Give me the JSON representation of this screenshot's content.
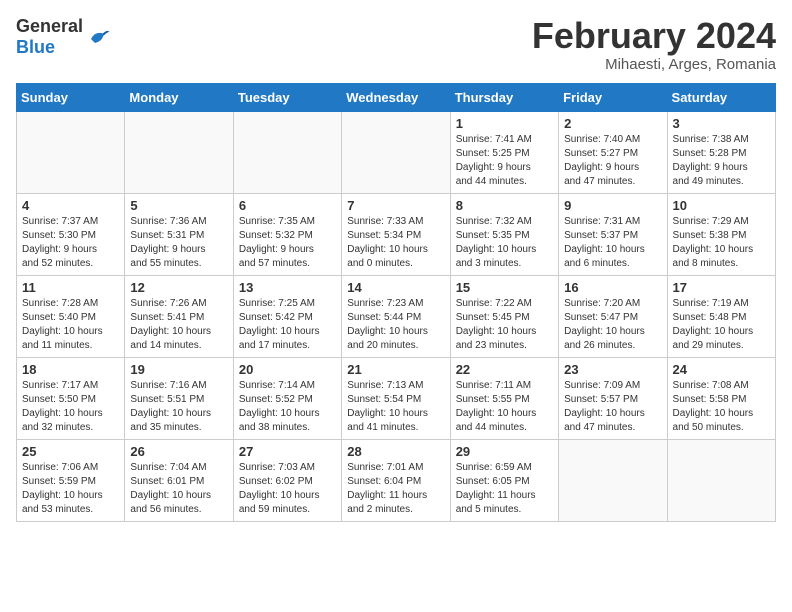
{
  "logo": {
    "general": "General",
    "blue": "Blue"
  },
  "title": "February 2024",
  "subtitle": "Mihaesti, Arges, Romania",
  "headers": [
    "Sunday",
    "Monday",
    "Tuesday",
    "Wednesday",
    "Thursday",
    "Friday",
    "Saturday"
  ],
  "weeks": [
    [
      {
        "num": "",
        "info": ""
      },
      {
        "num": "",
        "info": ""
      },
      {
        "num": "",
        "info": ""
      },
      {
        "num": "",
        "info": ""
      },
      {
        "num": "1",
        "info": "Sunrise: 7:41 AM\nSunset: 5:25 PM\nDaylight: 9 hours\nand 44 minutes."
      },
      {
        "num": "2",
        "info": "Sunrise: 7:40 AM\nSunset: 5:27 PM\nDaylight: 9 hours\nand 47 minutes."
      },
      {
        "num": "3",
        "info": "Sunrise: 7:38 AM\nSunset: 5:28 PM\nDaylight: 9 hours\nand 49 minutes."
      }
    ],
    [
      {
        "num": "4",
        "info": "Sunrise: 7:37 AM\nSunset: 5:30 PM\nDaylight: 9 hours\nand 52 minutes."
      },
      {
        "num": "5",
        "info": "Sunrise: 7:36 AM\nSunset: 5:31 PM\nDaylight: 9 hours\nand 55 minutes."
      },
      {
        "num": "6",
        "info": "Sunrise: 7:35 AM\nSunset: 5:32 PM\nDaylight: 9 hours\nand 57 minutes."
      },
      {
        "num": "7",
        "info": "Sunrise: 7:33 AM\nSunset: 5:34 PM\nDaylight: 10 hours\nand 0 minutes."
      },
      {
        "num": "8",
        "info": "Sunrise: 7:32 AM\nSunset: 5:35 PM\nDaylight: 10 hours\nand 3 minutes."
      },
      {
        "num": "9",
        "info": "Sunrise: 7:31 AM\nSunset: 5:37 PM\nDaylight: 10 hours\nand 6 minutes."
      },
      {
        "num": "10",
        "info": "Sunrise: 7:29 AM\nSunset: 5:38 PM\nDaylight: 10 hours\nand 8 minutes."
      }
    ],
    [
      {
        "num": "11",
        "info": "Sunrise: 7:28 AM\nSunset: 5:40 PM\nDaylight: 10 hours\nand 11 minutes."
      },
      {
        "num": "12",
        "info": "Sunrise: 7:26 AM\nSunset: 5:41 PM\nDaylight: 10 hours\nand 14 minutes."
      },
      {
        "num": "13",
        "info": "Sunrise: 7:25 AM\nSunset: 5:42 PM\nDaylight: 10 hours\nand 17 minutes."
      },
      {
        "num": "14",
        "info": "Sunrise: 7:23 AM\nSunset: 5:44 PM\nDaylight: 10 hours\nand 20 minutes."
      },
      {
        "num": "15",
        "info": "Sunrise: 7:22 AM\nSunset: 5:45 PM\nDaylight: 10 hours\nand 23 minutes."
      },
      {
        "num": "16",
        "info": "Sunrise: 7:20 AM\nSunset: 5:47 PM\nDaylight: 10 hours\nand 26 minutes."
      },
      {
        "num": "17",
        "info": "Sunrise: 7:19 AM\nSunset: 5:48 PM\nDaylight: 10 hours\nand 29 minutes."
      }
    ],
    [
      {
        "num": "18",
        "info": "Sunrise: 7:17 AM\nSunset: 5:50 PM\nDaylight: 10 hours\nand 32 minutes."
      },
      {
        "num": "19",
        "info": "Sunrise: 7:16 AM\nSunset: 5:51 PM\nDaylight: 10 hours\nand 35 minutes."
      },
      {
        "num": "20",
        "info": "Sunrise: 7:14 AM\nSunset: 5:52 PM\nDaylight: 10 hours\nand 38 minutes."
      },
      {
        "num": "21",
        "info": "Sunrise: 7:13 AM\nSunset: 5:54 PM\nDaylight: 10 hours\nand 41 minutes."
      },
      {
        "num": "22",
        "info": "Sunrise: 7:11 AM\nSunset: 5:55 PM\nDaylight: 10 hours\nand 44 minutes."
      },
      {
        "num": "23",
        "info": "Sunrise: 7:09 AM\nSunset: 5:57 PM\nDaylight: 10 hours\nand 47 minutes."
      },
      {
        "num": "24",
        "info": "Sunrise: 7:08 AM\nSunset: 5:58 PM\nDaylight: 10 hours\nand 50 minutes."
      }
    ],
    [
      {
        "num": "25",
        "info": "Sunrise: 7:06 AM\nSunset: 5:59 PM\nDaylight: 10 hours\nand 53 minutes."
      },
      {
        "num": "26",
        "info": "Sunrise: 7:04 AM\nSunset: 6:01 PM\nDaylight: 10 hours\nand 56 minutes."
      },
      {
        "num": "27",
        "info": "Sunrise: 7:03 AM\nSunset: 6:02 PM\nDaylight: 10 hours\nand 59 minutes."
      },
      {
        "num": "28",
        "info": "Sunrise: 7:01 AM\nSunset: 6:04 PM\nDaylight: 11 hours\nand 2 minutes."
      },
      {
        "num": "29",
        "info": "Sunrise: 6:59 AM\nSunset: 6:05 PM\nDaylight: 11 hours\nand 5 minutes."
      },
      {
        "num": "",
        "info": ""
      },
      {
        "num": "",
        "info": ""
      }
    ]
  ]
}
